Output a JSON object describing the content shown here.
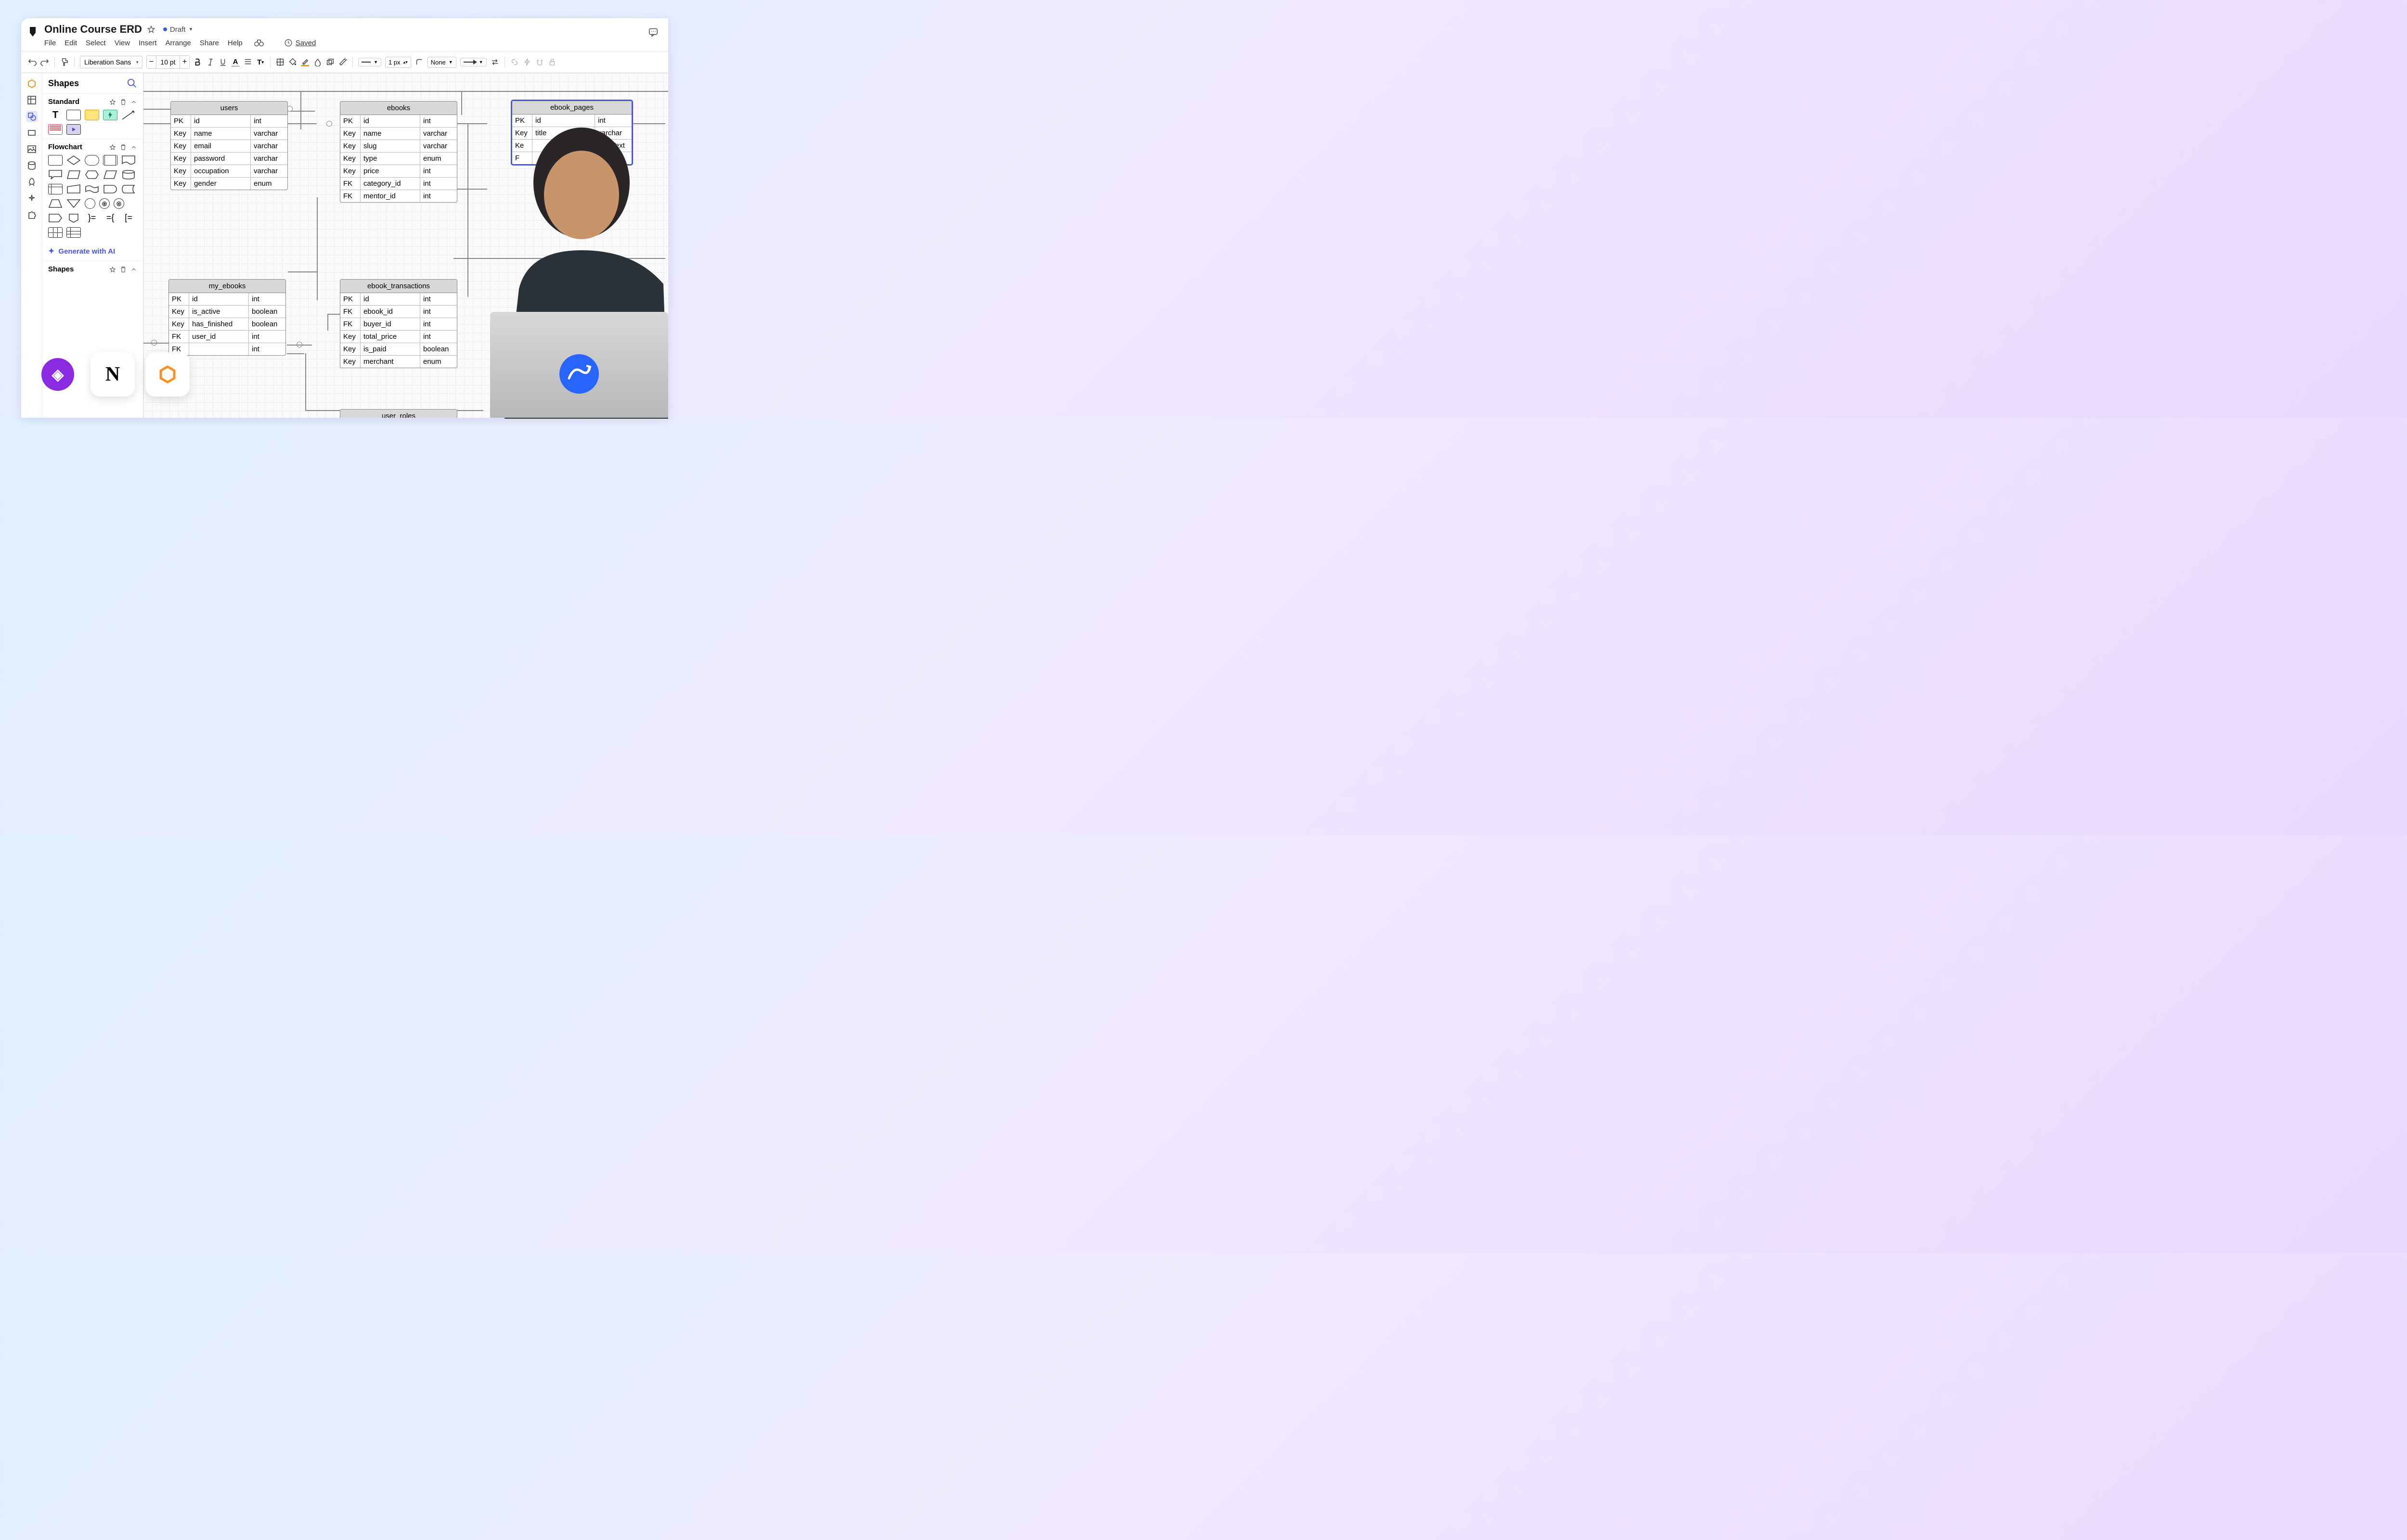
{
  "header": {
    "title": "Online Course ERD",
    "status": "Draft",
    "saved": "Saved",
    "menu": [
      "File",
      "Edit",
      "Select",
      "View",
      "Insert",
      "Arrange",
      "Share",
      "Help"
    ]
  },
  "toolbar": {
    "font": "Liberation Sans",
    "size": "10 pt",
    "line_width": "1 px",
    "line_style": "None"
  },
  "shapes_panel": {
    "title": "Shapes",
    "sections": [
      "Standard",
      "Flowchart",
      "Shapes"
    ],
    "generate": "Generate with AI"
  },
  "entities": {
    "users": {
      "name": "users",
      "rows": [
        {
          "key": "PK",
          "name": "id",
          "type": "int"
        },
        {
          "key": "Key",
          "name": "name",
          "type": "varchar"
        },
        {
          "key": "Key",
          "name": "email",
          "type": "varchar"
        },
        {
          "key": "Key",
          "name": "password",
          "type": "varchar"
        },
        {
          "key": "Key",
          "name": "occupation",
          "type": "varchar"
        },
        {
          "key": "Key",
          "name": "gender",
          "type": "enum"
        }
      ]
    },
    "ebooks": {
      "name": "ebooks",
      "rows": [
        {
          "key": "PK",
          "name": "id",
          "type": "int"
        },
        {
          "key": "Key",
          "name": "name",
          "type": "varchar"
        },
        {
          "key": "Key",
          "name": "slug",
          "type": "varchar"
        },
        {
          "key": "Key",
          "name": "type",
          "type": "enum"
        },
        {
          "key": "Key",
          "name": "price",
          "type": "int"
        },
        {
          "key": "FK",
          "name": "category_id",
          "type": "int"
        },
        {
          "key": "FK",
          "name": "mentor_id",
          "type": "int"
        }
      ]
    },
    "ebook_pages": {
      "name": "ebook_pages",
      "rows": [
        {
          "key": "PK",
          "name": "id",
          "type": "int"
        },
        {
          "key": "Key",
          "name": "title",
          "type": "varchar"
        },
        {
          "key": "Ke",
          "name": "",
          "type": "longText"
        },
        {
          "key": "F",
          "name": "",
          "type": ""
        }
      ]
    },
    "my_ebooks": {
      "name": "my_ebooks",
      "rows": [
        {
          "key": "PK",
          "name": "id",
          "type": "int"
        },
        {
          "key": "Key",
          "name": "is_active",
          "type": "boolean"
        },
        {
          "key": "Key",
          "name": "has_finished",
          "type": "boolean"
        },
        {
          "key": "FK",
          "name": "user_id",
          "type": "int"
        },
        {
          "key": "FK",
          "name": "",
          "type": "int"
        }
      ]
    },
    "ebook_transactions": {
      "name": "ebook_transactions",
      "rows": [
        {
          "key": "PK",
          "name": "id",
          "type": "int"
        },
        {
          "key": "FK",
          "name": "ebook_id",
          "type": "int"
        },
        {
          "key": "FK",
          "name": "buyer_id",
          "type": "int"
        },
        {
          "key": "Key",
          "name": "total_price",
          "type": "int"
        },
        {
          "key": "Key",
          "name": "is_paid",
          "type": "boolean"
        },
        {
          "key": "Key",
          "name": "merchant",
          "type": "enum"
        }
      ]
    },
    "user_roles": {
      "name": "user_roles"
    }
  },
  "app_icons": {
    "notion": "N"
  }
}
